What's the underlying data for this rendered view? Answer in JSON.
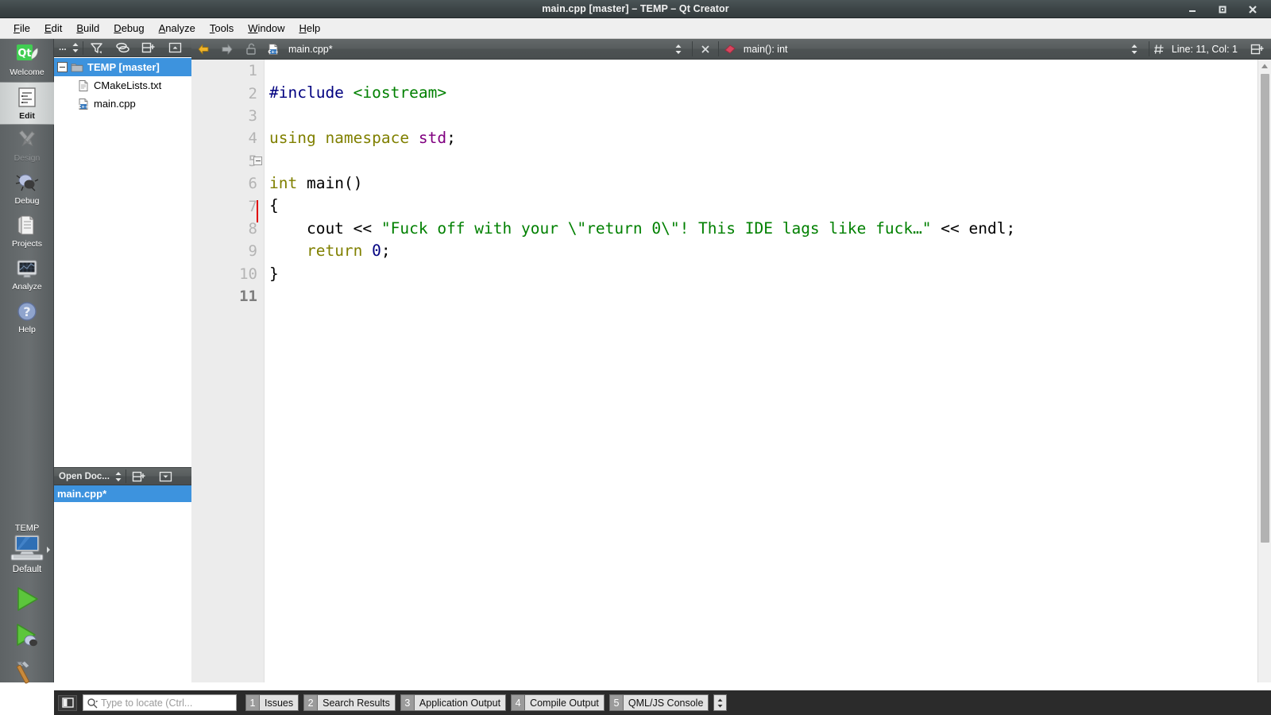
{
  "window": {
    "title": "main.cpp [master] – TEMP – Qt Creator",
    "minimize_label": "Minimize",
    "maximize_label": "Maximize",
    "close_label": "Close"
  },
  "menubar": {
    "items": [
      {
        "mnemonic": "F",
        "rest": "ile"
      },
      {
        "mnemonic": "E",
        "rest": "dit"
      },
      {
        "mnemonic": "B",
        "rest": "uild"
      },
      {
        "mnemonic": "D",
        "rest": "ebug"
      },
      {
        "mnemonic": "A",
        "rest": "nalyze"
      },
      {
        "mnemonic": "T",
        "rest": "ools"
      },
      {
        "mnemonic": "W",
        "rest": "indow"
      },
      {
        "mnemonic": "H",
        "rest": "elp"
      }
    ]
  },
  "modebar": {
    "modes": [
      {
        "label": "Welcome",
        "icon": "qt-logo-icon",
        "state": "normal"
      },
      {
        "label": "Edit",
        "icon": "document-edit-icon",
        "state": "selected"
      },
      {
        "label": "Design",
        "icon": "design-tools-icon",
        "state": "disabled"
      },
      {
        "label": "Debug",
        "icon": "bug-icon",
        "state": "normal"
      },
      {
        "label": "Projects",
        "icon": "folder-book-icon",
        "state": "normal"
      },
      {
        "label": "Analyze",
        "icon": "analyze-monitor-icon",
        "state": "normal"
      },
      {
        "label": "Help",
        "icon": "question-mark-icon",
        "state": "normal"
      }
    ],
    "kit": {
      "project": "TEMP",
      "configuration": "Default",
      "icon": "desktop-computer-icon",
      "run_label": "Run",
      "debug_label": "Start Debugging",
      "build_label": "Build"
    }
  },
  "project_panel": {
    "toolbar": {
      "menu_label": "...",
      "filter_label": "Filter Tree",
      "link_label": "Synchronize with Editor",
      "split_label": "Split",
      "close_label": "Close Sidebar"
    },
    "tree": [
      {
        "label": "TEMP [master]",
        "icon": "folder-icon",
        "level": 0,
        "selected": true
      },
      {
        "label": "CMakeLists.txt",
        "icon": "text-file-icon",
        "level": 1,
        "selected": false
      },
      {
        "label": "main.cpp",
        "icon": "cpp-file-icon",
        "level": 1,
        "selected": false
      }
    ],
    "open_documents": {
      "header": "Open Doc...",
      "items": [
        {
          "label": "main.cpp*",
          "selected": true
        }
      ]
    }
  },
  "editor_toolbar": {
    "back_label": "Go Back",
    "forward_label": "Go Forward",
    "lock_label": "Make Writable",
    "file_icon": "cpp-file-icon",
    "filename": "main.cpp*",
    "close_label": "Close Document",
    "symbol_icon": "function-diamond-icon",
    "symbol": "main(): int",
    "position_icon": "line-number-icon",
    "position": "Line: 11, Col: 1",
    "split_label": "Split"
  },
  "editor": {
    "line_numbers": [
      "1",
      "2",
      "3",
      "4",
      "5",
      "6",
      "7",
      "8",
      "9",
      "10",
      "11"
    ],
    "current_line": 11,
    "fold_line": 5,
    "caret_line": 7,
    "code_lines": [
      [
        {
          "t": "#include ",
          "c": "pre"
        },
        {
          "t": "<iostream>",
          "c": "inc"
        }
      ],
      [],
      [
        {
          "t": "using namespace ",
          "c": "kw"
        },
        {
          "t": "std",
          "c": "ns"
        },
        {
          "t": ";",
          "c": "op"
        }
      ],
      [],
      [
        {
          "t": "int",
          "c": "type"
        },
        {
          "t": " ",
          "c": "op"
        },
        {
          "t": "main",
          "c": "fn"
        },
        {
          "t": "()",
          "c": "op"
        }
      ],
      [
        {
          "t": "{",
          "c": "op"
        }
      ],
      [
        {
          "t": "    cout << ",
          "c": "op"
        },
        {
          "t": "\"Fuck off with your \\\"return 0\\\"! This IDE lags like fuck…\"",
          "c": "str"
        },
        {
          "t": " << endl;",
          "c": "op"
        }
      ],
      [
        {
          "t": "    ",
          "c": "op"
        },
        {
          "t": "return",
          "c": "kw"
        },
        {
          "t": " ",
          "c": "op"
        },
        {
          "t": "0",
          "c": "num"
        },
        {
          "t": ";",
          "c": "op"
        }
      ],
      [
        {
          "t": "}",
          "c": "op"
        }
      ],
      [],
      []
    ]
  },
  "statusbar": {
    "sidebar_toggle_label": "Toggle Sidebar",
    "locator_placeholder": "Type to locate (Ctrl...",
    "output_panes": [
      {
        "num": "1",
        "label": "Issues"
      },
      {
        "num": "2",
        "label": "Search Results"
      },
      {
        "num": "3",
        "label": "Application Output"
      },
      {
        "num": "4",
        "label": "Compile Output"
      },
      {
        "num": "5",
        "label": "QML/JS Console"
      }
    ]
  },
  "colors": {
    "accent_blue": "#3d93de",
    "titlebar": "#3d4547",
    "toolbar_dark": "#585d5e",
    "modebar": "#6a6f71",
    "statusbar": "#2b2b2b",
    "gutter": "#ececec",
    "string_green": "#008000",
    "keyword_olive": "#808000",
    "preproc_navy": "#000080",
    "namespace_magenta": "#800080",
    "caret_red": "#e00000"
  }
}
